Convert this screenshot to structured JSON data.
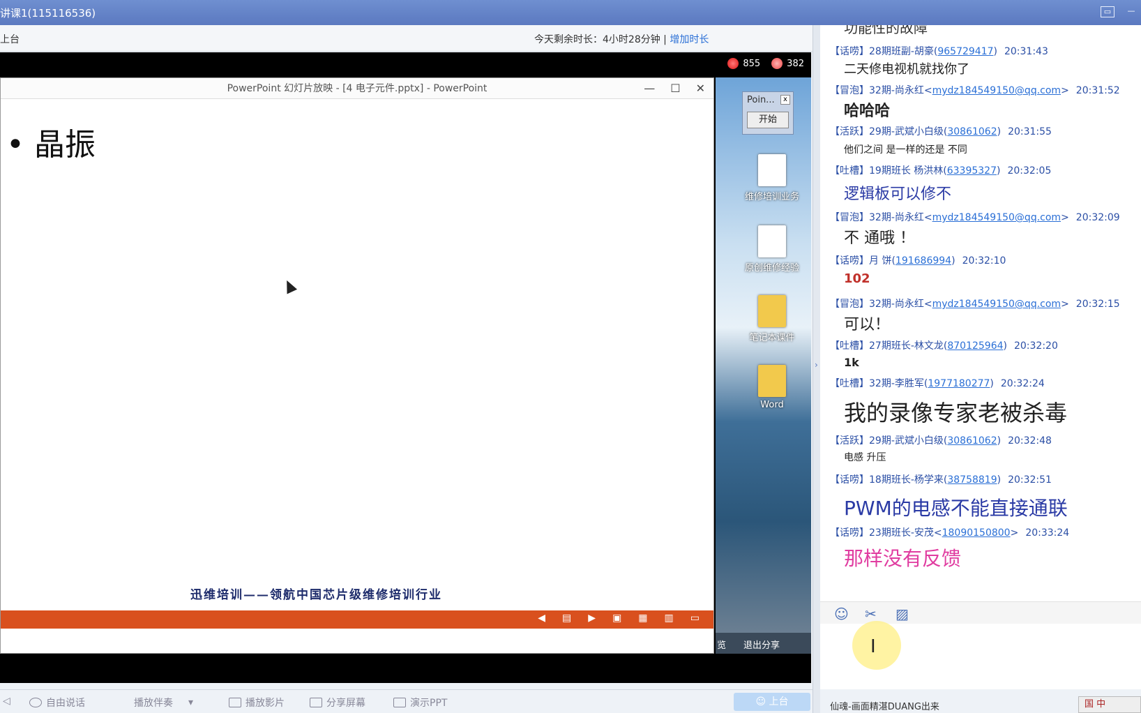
{
  "window": {
    "title": "讲课1(115116536)"
  },
  "subbar": {
    "left_label": "上台",
    "remaining_prefix": "今天剩余时长：4小时28分钟",
    "separator": " | ",
    "add_time_link": "增加时长"
  },
  "counters": {
    "flowers": "855",
    "candy": "382"
  },
  "ppt": {
    "window_title": "PowerPoint 幻灯片放映 - [4 电子元件.pptx] - PowerPoint",
    "ctrl_min": "—",
    "ctrl_max": "☐",
    "ctrl_close": "✕",
    "bullet_text": "• 晶振",
    "footer_text": "迅维培训——领航中国芯片级维修培训行业"
  },
  "desktop": {
    "pointer_title": "Poin...",
    "pointer_close": "x",
    "pointer_start": "开始",
    "icons": [
      {
        "label": "维修培训业务"
      },
      {
        "label": "原创维修经验"
      },
      {
        "label": "笔记本课件"
      },
      {
        "label": "Word"
      }
    ],
    "bottom_left": "览",
    "bottom_right": "退出分享"
  },
  "bottombar": {
    "free_talk": "自由说话",
    "play_music": "播放伴奏",
    "play_movie": "播放影片",
    "share_screen": "分享屏幕",
    "show_ppt": "演示PPT",
    "go_stage": "上台"
  },
  "chat": {
    "partial_top": "功能性的故障",
    "messages": [
      {
        "tag": "【话唠】",
        "name": "28期班副-胡豪",
        "id": "965729417",
        "id_wrap": "paren",
        "time": "20:31:43",
        "body": "二天修电视机就找你了",
        "body_color": "#222",
        "body_size": "18px",
        "body_weight": "normal"
      },
      {
        "tag": "【冒泡】",
        "name": "32期-尚永红",
        "id": "mydz184549150@qq.com",
        "id_wrap": "angle",
        "time": "20:31:52",
        "body": "哈哈哈",
        "body_color": "#222",
        "body_size": "22px",
        "body_weight": "bold"
      },
      {
        "tag": "【活跃】",
        "name": "29期-武斌小白级",
        "id": "30861062",
        "id_wrap": "paren",
        "time": "20:31:55",
        "body": "他们之间 是一样的还是 不同",
        "body_color": "#222",
        "body_size": "14px",
        "body_weight": "normal"
      },
      {
        "tag": "【吐槽】",
        "name": "19期班长 杨洪林",
        "id": "63395327",
        "id_wrap": "paren",
        "time": "20:32:05",
        "body": "逻辑板可以修不",
        "body_color": "#2a3aa5",
        "body_size": "22px",
        "body_weight": "normal"
      },
      {
        "tag": "【冒泡】",
        "name": "32期-尚永红",
        "id": "mydz184549150@qq.com",
        "id_wrap": "angle",
        "time": "20:32:09",
        "body": "不 通哦 ！",
        "body_color": "#222",
        "body_size": "22px",
        "body_weight": "normal"
      },
      {
        "tag": "【话唠】",
        "name": "月 饼",
        "id": "191686994",
        "id_wrap": "paren",
        "time": "20:32:10",
        "body": "102",
        "body_color": "#c0302a",
        "body_size": "18px",
        "body_weight": "bold"
      },
      {
        "tag": "【冒泡】",
        "name": "32期-尚永红",
        "id": "mydz184549150@qq.com",
        "id_wrap": "angle",
        "time": "20:32:15",
        "body": "可以！",
        "body_color": "#222",
        "body_size": "22px",
        "body_weight": "normal"
      },
      {
        "tag": "【吐槽】",
        "name": "27期班长-林文龙",
        "id": "870125964",
        "id_wrap": "paren",
        "time": "20:32:20",
        "body": "1k",
        "body_color": "#222",
        "body_size": "16px",
        "body_weight": "bold"
      },
      {
        "tag": "【吐槽】",
        "name": "32期-李胜军",
        "id": "1977180277",
        "id_wrap": "paren",
        "time": "20:32:24",
        "body": "我的录像专家老被杀毒",
        "body_color": "#222",
        "body_size": "32px",
        "body_weight": "normal"
      },
      {
        "tag": "【活跃】",
        "name": "29期-武斌小白级",
        "id": "30861062",
        "id_wrap": "paren",
        "time": "20:32:48",
        "body": "电感 升压",
        "body_color": "#222",
        "body_size": "14px",
        "body_weight": "normal"
      },
      {
        "tag": "【话唠】",
        "name": "18期班长-杨学来",
        "id": "38758819",
        "id_wrap": "paren",
        "time": "20:32:51",
        "body": "PWM的电感不能直接通联",
        "body_color": "#2a3aa5",
        "body_size": "28px",
        "body_weight": "normal"
      },
      {
        "tag": "【话唠】",
        "name": "23期班长-安茂",
        "id": "18090150800",
        "id_wrap": "angle",
        "time": "20:33:24",
        "body": "那样没有反馈",
        "body_color": "#e03ca0",
        "body_size": "28px",
        "body_weight": "normal"
      }
    ],
    "status_text": "仙魂-画面精湛DUANG出来",
    "ime_text": "国 中"
  }
}
